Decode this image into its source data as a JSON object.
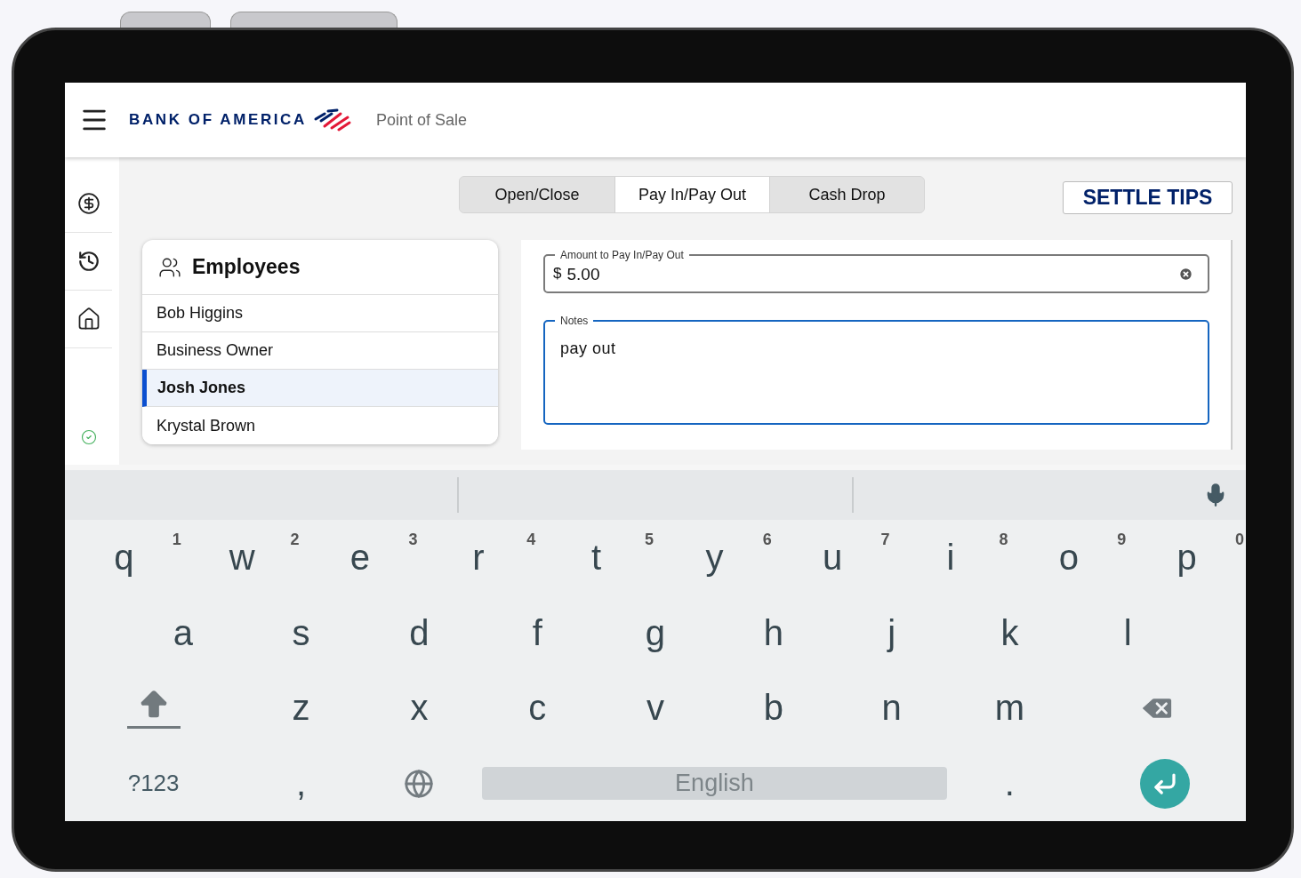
{
  "header": {
    "logo": "BANK OF AMERICA",
    "title": "Point of Sale"
  },
  "tabs": [
    {
      "label": "Open/Close",
      "selected": false
    },
    {
      "label": "Pay In/Pay Out",
      "selected": true
    },
    {
      "label": "Cash Drop",
      "selected": false
    }
  ],
  "settle_button": "SETTLE TIPS",
  "employees": {
    "title": "Employees",
    "items": [
      {
        "name": "Bob Higgins",
        "selected": false
      },
      {
        "name": "Business Owner",
        "selected": false
      },
      {
        "name": "Josh Jones",
        "selected": true
      },
      {
        "name": "Krystal Brown",
        "selected": false
      }
    ]
  },
  "amount_field": {
    "label": "Amount to Pay In/Pay Out",
    "prefix": "$",
    "value": "5.00",
    "focused": false
  },
  "notes_field": {
    "label": "Notes",
    "value": "pay out",
    "focused": true
  },
  "keyboard": {
    "rows": [
      {
        "keys": [
          {
            "kind": "letter",
            "label": "q",
            "hint": "1"
          },
          {
            "kind": "letter",
            "label": "w",
            "hint": "2"
          },
          {
            "kind": "letter",
            "label": "e",
            "hint": "3"
          },
          {
            "kind": "letter",
            "label": "r",
            "hint": "4"
          },
          {
            "kind": "letter",
            "label": "t",
            "hint": "5"
          },
          {
            "kind": "letter",
            "label": "y",
            "hint": "6"
          },
          {
            "kind": "letter",
            "label": "u",
            "hint": "7"
          },
          {
            "kind": "letter",
            "label": "i",
            "hint": "8"
          },
          {
            "kind": "letter",
            "label": "o",
            "hint": "9"
          },
          {
            "kind": "letter",
            "label": "p",
            "hint": "0"
          }
        ]
      },
      {
        "keys": [
          {
            "kind": "letter",
            "label": "a"
          },
          {
            "kind": "letter",
            "label": "s"
          },
          {
            "kind": "letter",
            "label": "d"
          },
          {
            "kind": "letter",
            "label": "f"
          },
          {
            "kind": "letter",
            "label": "g"
          },
          {
            "kind": "letter",
            "label": "h"
          },
          {
            "kind": "letter",
            "label": "j"
          },
          {
            "kind": "letter",
            "label": "k"
          },
          {
            "kind": "letter",
            "label": "l"
          }
        ]
      },
      {
        "keys": [
          {
            "kind": "shift"
          },
          {
            "kind": "letter",
            "label": "z"
          },
          {
            "kind": "letter",
            "label": "x"
          },
          {
            "kind": "letter",
            "label": "c"
          },
          {
            "kind": "letter",
            "label": "v"
          },
          {
            "kind": "letter",
            "label": "b"
          },
          {
            "kind": "letter",
            "label": "n"
          },
          {
            "kind": "letter",
            "label": "m"
          },
          {
            "kind": "backspace"
          }
        ]
      },
      {
        "keys": [
          {
            "kind": "symbols",
            "label": "?123"
          },
          {
            "kind": "letter",
            "label": ","
          },
          {
            "kind": "globe"
          },
          {
            "kind": "space",
            "label": "English"
          },
          {
            "kind": "letter",
            "label": "."
          },
          {
            "kind": "enter"
          }
        ]
      }
    ]
  }
}
